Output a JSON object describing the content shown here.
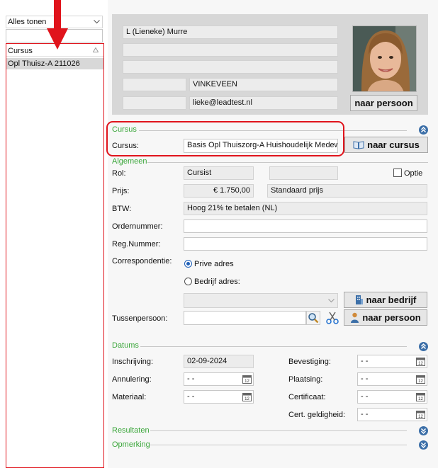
{
  "sidebar": {
    "filter_value": "Alles tonen",
    "search_value": "",
    "column_header": "Cursus",
    "items": [
      {
        "label": "Opl Thuisz-A 211026"
      }
    ]
  },
  "person": {
    "name": "L (Lieneke) Murre",
    "line2": "",
    "line3": "",
    "postcode": "",
    "city": "VINKEVEEN",
    "phone": "",
    "email": "lieke@leadtest.nl",
    "to_person_label": "naar persoon"
  },
  "cursus_section": {
    "title": "Cursus",
    "label": "Cursus:",
    "value": "Basis Opl Thuiszorg-A Huishoudelijk Medewer",
    "button_label": "naar cursus"
  },
  "algemeen": {
    "title": "Algemeen",
    "rol_label": "Rol:",
    "rol_value": "Cursist",
    "optie_label": "Optie",
    "prijs_label": "Prijs:",
    "prijs_value": "€ 1.750,00",
    "prijs_type": "Standaard prijs",
    "btw_label": "BTW:",
    "btw_value": "Hoog 21% te betalen (NL)",
    "ordernummer_label": "Ordernummer:",
    "ordernummer_value": "",
    "regnummer_label": "Reg.Nummer:",
    "regnummer_value": "",
    "correspondentie_label": "Correspondentie:",
    "prive_label": "Prive adres",
    "bedrijf_label": "Bedrijf adres:",
    "bedrijf_value": "",
    "naar_bedrijf_label": "naar bedrijf",
    "tussenpersoon_label": "Tussenpersoon:",
    "tussenpersoon_value": "",
    "naar_persoon_label": "naar persoon"
  },
  "datums": {
    "title": "Datums",
    "inschrijving_label": "Inschrijving:",
    "inschrijving_value": "02-09-2024",
    "annulering_label": "Annulering:",
    "annulering_value": "- -",
    "materiaal_label": "Materiaal:",
    "materiaal_value": "- -",
    "bevestiging_label": "Bevestiging:",
    "bevestiging_value": "- -",
    "plaatsing_label": "Plaatsing:",
    "plaatsing_value": "- -",
    "certificaat_label": "Certificaat:",
    "certificaat_value": "- -",
    "certgeldig_label": "Cert. geldigheid:",
    "certgeldig_value": "- -"
  },
  "resultaten": {
    "title": "Resultaten"
  },
  "opmerking": {
    "title": "Opmerking"
  },
  "colors": {
    "accent_green": "#3aa63a",
    "highlight_red": "#e0141c",
    "selection": "#d8d8d8"
  }
}
